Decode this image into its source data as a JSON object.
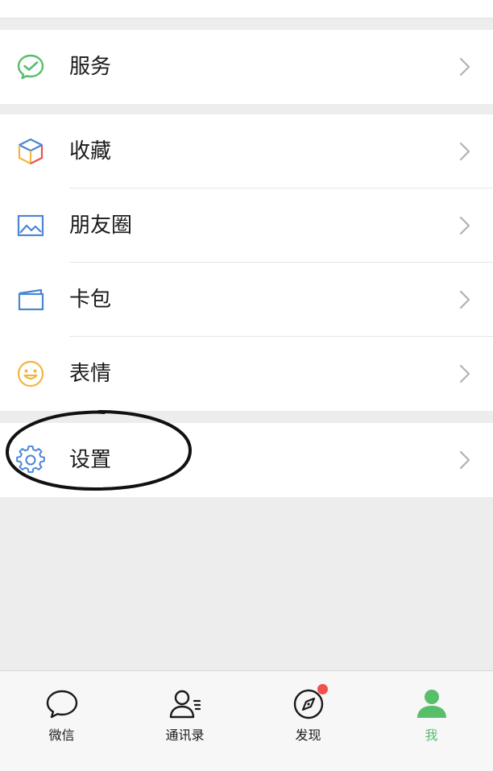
{
  "menu": {
    "services": {
      "label": "服务",
      "icon": "wechat-pay-check-icon"
    },
    "favorites": {
      "label": "收藏",
      "icon": "cube-icon"
    },
    "moments": {
      "label": "朋友圈",
      "icon": "picture-icon"
    },
    "cards": {
      "label": "卡包",
      "icon": "card-wallet-icon"
    },
    "stickers": {
      "label": "表情",
      "icon": "smiley-icon"
    },
    "settings": {
      "label": "设置",
      "icon": "gear-icon"
    }
  },
  "tabs": [
    {
      "label": "微信",
      "icon": "chat-bubble-icon",
      "active": false
    },
    {
      "label": "通讯录",
      "icon": "contacts-icon",
      "active": false
    },
    {
      "label": "发现",
      "icon": "compass-icon",
      "active": false,
      "badge": "dot"
    },
    {
      "label": "我",
      "icon": "person-icon",
      "active": true
    }
  ],
  "colors": {
    "background": "#ededed",
    "active_green": "#57be6a",
    "badge_red": "#f0524a",
    "settings_blue": "#4a86d4"
  }
}
